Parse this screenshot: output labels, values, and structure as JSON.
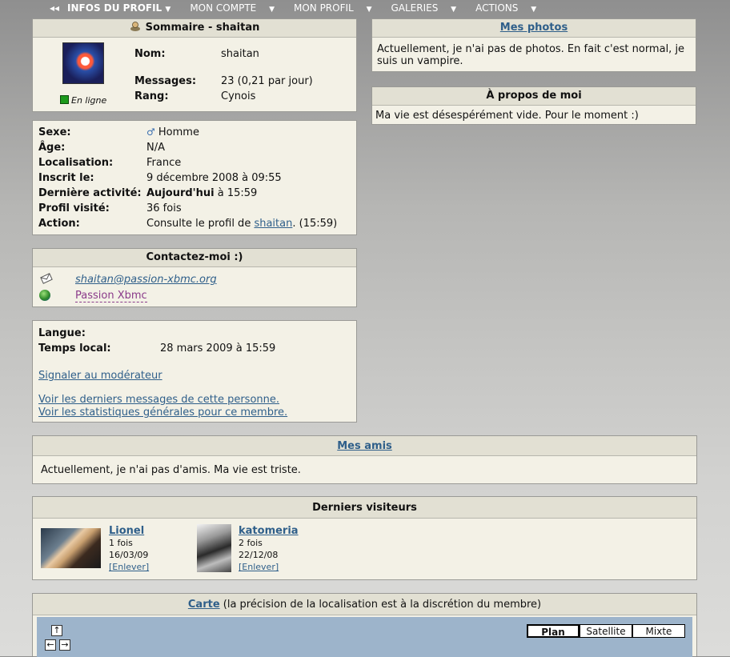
{
  "nav": {
    "items": [
      "Infos du profil",
      "Mon compte",
      "Mon profil",
      "Galeries",
      "Actions"
    ]
  },
  "summary": {
    "title": "Sommaire - shaitan",
    "status": "En ligne",
    "rows": [
      {
        "label": "Nom:",
        "value": "shaitan"
      },
      {
        "label": "Messages:",
        "value": "23 (0,21 par jour)"
      },
      {
        "label": "Rang:",
        "value": "Cynois"
      }
    ]
  },
  "details": {
    "sexe_label": "Sexe:",
    "sexe_value": "Homme",
    "age_label": "Âge:",
    "age_value": "N/A",
    "loc_label": "Localisation:",
    "loc_value": "France",
    "inscrit_label": "Inscrit le:",
    "inscrit_value": "9 décembre 2008 à 09:55",
    "activite_label": "Dernière activité:",
    "activite_bold": "Aujourd'hui",
    "activite_rest": " à 15:59",
    "visite_label": "Profil visité:",
    "visite_value": "36 fois",
    "action_label": "Action:",
    "action_pre": "Consulte le profil de ",
    "action_link": "shaitan",
    "action_post": ". (15:59)"
  },
  "contact": {
    "title": "Contactez-moi :)",
    "email": "shaitan@passion-xbmc.org",
    "website": "Passion Xbmc"
  },
  "misc": {
    "langue_label": "Langue:",
    "temps_label": "Temps local:",
    "temps_value": "28 mars 2009 à 15:59",
    "report_link": "Signaler au modérateur",
    "last_messages_link": "Voir les derniers messages de cette personne.",
    "stats_link": "Voir les statistiques générales pour ce membre."
  },
  "photos": {
    "title": "Mes photos",
    "text": "Actuellement, je n'ai pas de photos. En fait c'est normal, je suis un vampire."
  },
  "about": {
    "title": "À propos de moi",
    "text": "Ma vie est désespérément vide. Pour le moment :)"
  },
  "friends": {
    "title": "Mes amis",
    "text": "Actuellement, je n'ai pas d'amis. Ma vie est triste."
  },
  "visitors": {
    "title": "Derniers visiteurs",
    "items": [
      {
        "name": "Lionel",
        "count": "1 fois",
        "date": "16/03/09",
        "remove": "[Enlever]"
      },
      {
        "name": "katomeria",
        "count": "2 fois",
        "date": "22/12/08",
        "remove": "[Enlever]"
      }
    ]
  },
  "map": {
    "title_link": "Carte",
    "title_rest": " (la précision de la localisation est à la discrétion du membre)",
    "buttons": [
      "Plan",
      "Satellite",
      "Mixte"
    ],
    "active_button": "Plan",
    "bg_color": "#9db4cb"
  }
}
